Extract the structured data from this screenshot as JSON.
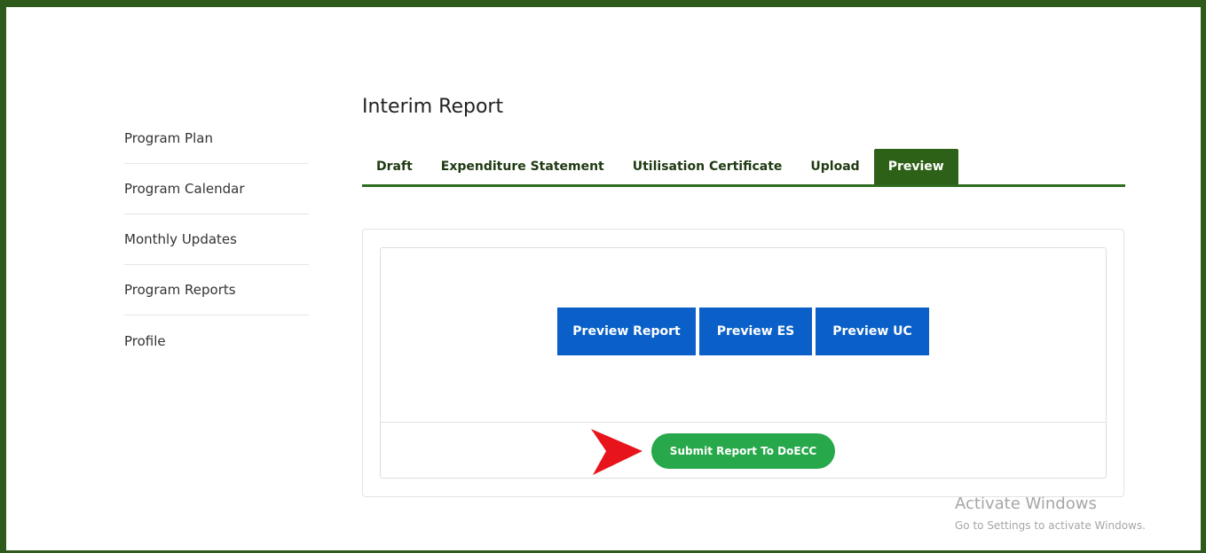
{
  "sidebar": {
    "items": [
      {
        "label": "Program Plan"
      },
      {
        "label": "Program Calendar"
      },
      {
        "label": "Monthly Updates"
      },
      {
        "label": "Program Reports"
      },
      {
        "label": "Profile"
      }
    ]
  },
  "page": {
    "title": "Interim Report"
  },
  "tabs": [
    {
      "label": "Draft",
      "active": false
    },
    {
      "label": "Expenditure Statement",
      "active": false
    },
    {
      "label": "Utilisation Certificate",
      "active": false
    },
    {
      "label": "Upload",
      "active": false
    },
    {
      "label": "Preview",
      "active": true
    }
  ],
  "preview_buttons": {
    "report": "Preview Report",
    "es": "Preview ES",
    "uc": "Preview UC"
  },
  "submit": {
    "label": "Submit Report To DoECC"
  },
  "watermark": {
    "title": "Activate Windows",
    "subtitle": "Go to Settings to activate Windows."
  },
  "colors": {
    "frame": "#2e5a1c",
    "tab_active": "#2e6118",
    "preview_button": "#0a60c8",
    "submit_button": "#27a84a",
    "annotation_arrow": "#e8141b"
  },
  "icons": {
    "annotation": "red-arrow-icon"
  }
}
